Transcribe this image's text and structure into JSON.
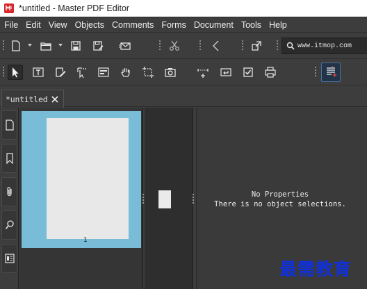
{
  "window": {
    "title": "*untitled - Master PDF Editor",
    "app_icon": "master-pdf-icon",
    "accent": "#d8262c"
  },
  "menu": [
    "File",
    "Edit",
    "View",
    "Objects",
    "Comments",
    "Forms",
    "Document",
    "Tools",
    "Help"
  ],
  "toolbar1": {
    "icons": [
      "new-document-icon",
      "open-folder-icon",
      "save-icon",
      "save-as-icon",
      "email-icon",
      "cut-icon",
      "back-icon",
      "crop-icon",
      "search-icon"
    ],
    "search_value": "www.itmop.com"
  },
  "toolbar2": {
    "icons": [
      "select-arrow-icon",
      "text-edit-icon",
      "edit-object-icon",
      "add-link-icon",
      "form-field-icon",
      "hand-icon",
      "snapshot-select-icon",
      "camera-icon",
      "measure-icon",
      "enter-icon",
      "checkbox-icon",
      "print-icon",
      "redact-icon"
    ]
  },
  "tab": {
    "label": "*untitled"
  },
  "sidebar": {
    "buttons": [
      "pages-icon",
      "bookmarks-icon",
      "attachments-icon",
      "search-icon",
      "layers-icon"
    ]
  },
  "thumbnail": {
    "page_number": "1",
    "highlight": "#78bcd8"
  },
  "properties": {
    "title": "No Properties",
    "message": "There is no object selections."
  },
  "watermark": "最需教育"
}
